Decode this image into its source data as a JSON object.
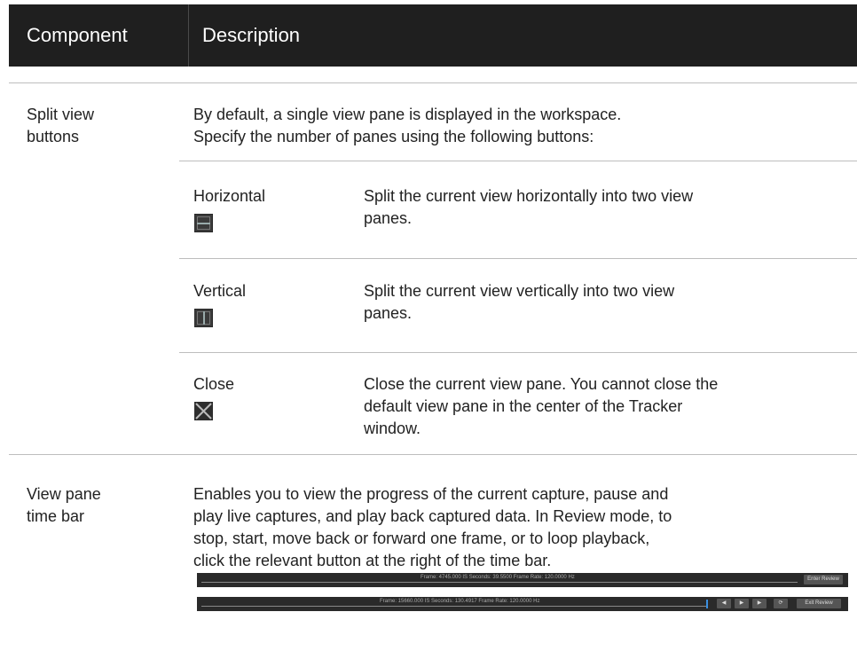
{
  "header": {
    "component": "Component",
    "description": "Description"
  },
  "split": {
    "component_lines": [
      "Split view",
      "buttons"
    ],
    "desc_lines": [
      "By default, a single view pane is displayed in the workspace.",
      "Specify the number of panes using the following buttons:"
    ],
    "items": [
      {
        "name": "Horizontal",
        "icon": "split-horizontal-icon",
        "lines": [
          "Split the current view horizontally into two view",
          "panes."
        ]
      },
      {
        "name": "Vertical",
        "icon": "split-vertical-icon",
        "lines": [
          "Split the current view vertically into two view",
          "panes."
        ]
      },
      {
        "name": "Close",
        "icon": "close-icon",
        "lines": [
          "Close the current view pane. You cannot close the",
          "default view pane in the center of the Tracker",
          "window."
        ]
      }
    ]
  },
  "timebar": {
    "component_lines": [
      "View pane",
      "time bar"
    ],
    "desc_lines": [
      "Enables you to view the progress of the current capture, pause and",
      "play live captures, and play back captured data. In Review mode, to",
      "stop, start, move back or forward one frame, or to loop playback,",
      "click the relevant button at the right of the time bar."
    ],
    "bar1": {
      "info": "Frame: 4745.000 IS   Seconds: 39.5500   Frame Rate: 120.0000 Hz",
      "button": "Enter Review"
    },
    "bar2": {
      "info": "Frame: 15660.000 IS   Seconds: 130.4917   Frame Rate: 120.0000 Hz",
      "button": "Exit Review"
    }
  },
  "colors": {
    "header_bg": "#1f1f1f",
    "rule": "#bdbdbd",
    "timebar_bg": "#2a2a2a",
    "marker": "#3a8fe0"
  }
}
